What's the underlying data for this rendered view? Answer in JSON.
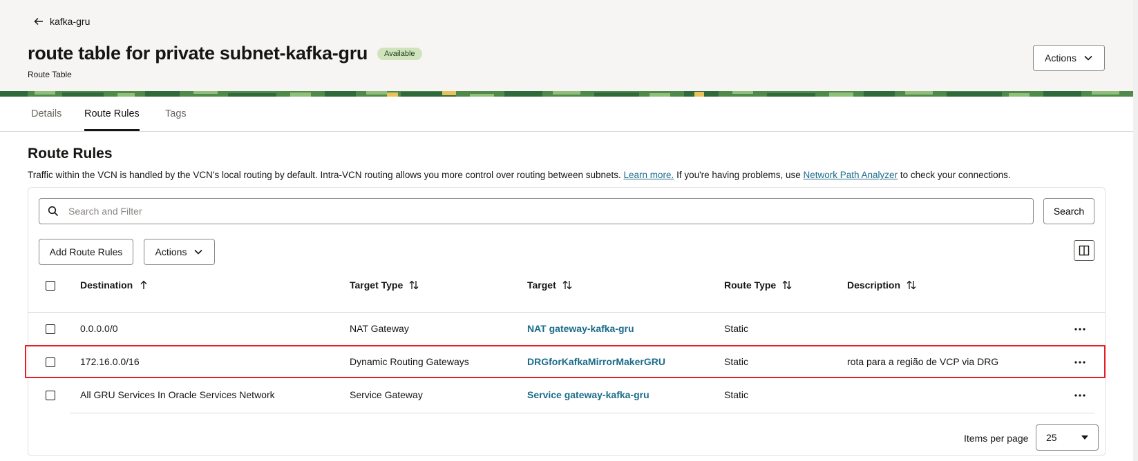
{
  "header": {
    "back_label": "kafka-gru",
    "title": "route table for private subnet-kafka-gru",
    "status": "Available",
    "subtitle": "Route Table",
    "actions_label": "Actions"
  },
  "tabs": [
    {
      "label": "Details",
      "active": false
    },
    {
      "label": "Route Rules",
      "active": true
    },
    {
      "label": "Tags",
      "active": false
    }
  ],
  "section": {
    "title": "Route Rules",
    "desc_part1": "Traffic within the VCN is handled by the VCN's local routing by default. Intra-VCN routing allows you more control over routing between subnets. ",
    "learn_more": "Learn more.",
    "desc_part2": " If you're having problems, use ",
    "npa_link": "Network Path Analyzer",
    "desc_part3": " to check your connections."
  },
  "search": {
    "placeholder": "Search and Filter",
    "value": "",
    "button_label": "Search"
  },
  "toolbar": {
    "add_label": "Add Route Rules",
    "actions_label": "Actions"
  },
  "table": {
    "columns": [
      "Destination",
      "Target Type",
      "Target",
      "Route Type",
      "Description"
    ],
    "rows": [
      {
        "destination": "0.0.0.0/0",
        "target_type": "NAT Gateway",
        "target": "NAT gateway-kafka-gru",
        "route_type": "Static",
        "description": ""
      },
      {
        "destination": "172.16.0.0/16",
        "target_type": "Dynamic Routing Gateways",
        "target": "DRGforKafkaMirrorMakerGRU",
        "route_type": "Static",
        "description": "rota para a região de VCP via DRG"
      },
      {
        "destination": "All GRU Services In Oracle Services Network",
        "target_type": "Service Gateway",
        "target": "Service gateway-kafka-gru",
        "route_type": "Static",
        "description": ""
      }
    ]
  },
  "pagination": {
    "items_per_page_label": "Items per page",
    "items_per_page_value": "25"
  },
  "colors": {
    "link": "#1a6b8a",
    "badge_bg": "#cfe3bd",
    "highlight": "#e31e24"
  }
}
